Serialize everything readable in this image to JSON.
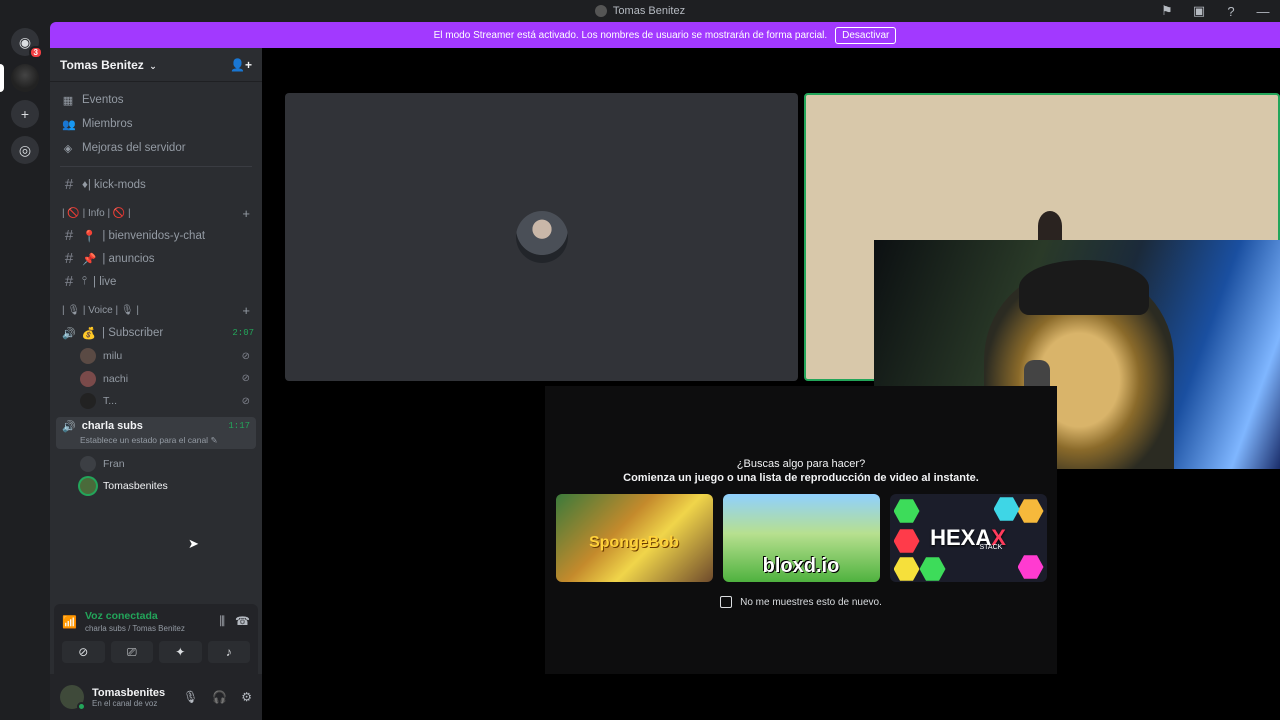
{
  "titlebar": {
    "title": "Tomas Benitez"
  },
  "banner": {
    "text": "El modo Streamer está activado. Los nombres de usuario se mostrarán de forma parcial.",
    "button": "Desactivar"
  },
  "rail": {
    "home_badge": "3"
  },
  "server": {
    "name": "Tomas Benitez"
  },
  "nav": [
    {
      "label": "Eventos"
    },
    {
      "label": "Miembros"
    },
    {
      "label": "Mejoras del servidor"
    }
  ],
  "channels": {
    "kick": "♦| kick-mods",
    "info_category": "| 🚫 | Info | 🚫 |",
    "bienvenidos": "| bienvenidos-y-chat",
    "anuncios": "| anuncios",
    "live": "| live",
    "voice_category": "| 🎙 | Voice | 🎙 |",
    "subscriber": "| Subscriber",
    "subscriber_timer": "2:07",
    "subscriber_users": [
      "milu",
      "nachi",
      "T..."
    ],
    "charla": "charla subs",
    "charla_timer": "1:17",
    "charla_status": "Establece un estado para el canal",
    "charla_users": [
      "Fran",
      "Tomasbenites"
    ]
  },
  "voice_panel": {
    "title": "Voz conectada",
    "sub": "charla subs / Tomas Benitez"
  },
  "user_panel": {
    "name": "Tomasbenites",
    "status": "En el canal de voz"
  },
  "activity": {
    "question": "¿Buscas algo para hacer?",
    "subtitle": "Comienza un juego o una lista de reproducción de video al instante.",
    "cards": [
      "SpongeBob",
      "bloxd.io",
      "HEXA"
    ],
    "hexa_x": "X",
    "hexa_stack": "STACK",
    "dont_show": "No me muestres esto de nuevo."
  }
}
